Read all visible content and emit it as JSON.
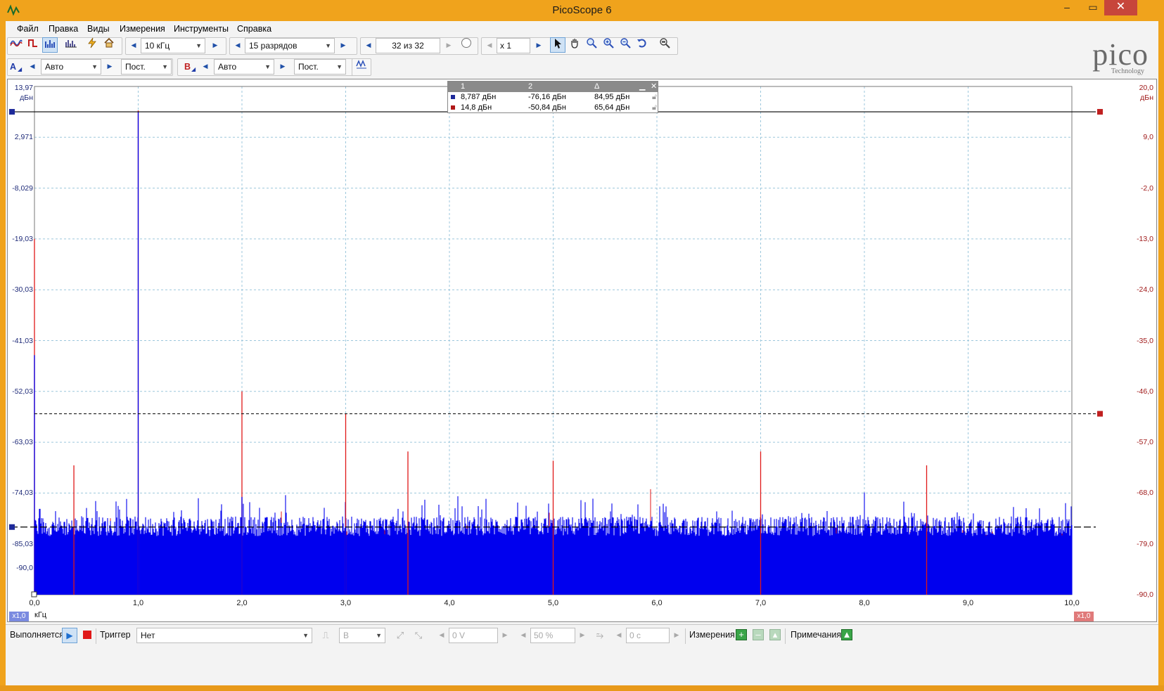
{
  "window": {
    "title": "PicoScope 6",
    "minimize": "–",
    "maximize": "▭",
    "close": "✕"
  },
  "menu": [
    "Файл",
    "Правка",
    "Виды",
    "Измерения",
    "Инструменты",
    "Справка"
  ],
  "toolbar1": {
    "freq_range": "10 кГц",
    "resolution": "15 разрядов",
    "buffer": "32 из 32",
    "zoom": "x 1"
  },
  "toolbar2": {
    "channel_a_label": "A",
    "channel_a_range": "Авто",
    "channel_a_coupling": "Пост.",
    "channel_b_label": "B",
    "channel_b_range": "Авто",
    "channel_b_coupling": "Пост."
  },
  "logo": {
    "text": "pico",
    "sub": "Technology"
  },
  "chart_data": {
    "type": "line",
    "xlabel": "кГц",
    "x_ticks": [
      "0,0",
      "1,0",
      "2,0",
      "3,0",
      "4,0",
      "5,0",
      "6,0",
      "7,0",
      "8,0",
      "9,0",
      "10,0"
    ],
    "xlim": [
      0,
      10
    ],
    "left_axis": {
      "unit": "дБн",
      "ticks": [
        "13,97",
        "2,971",
        "-8,029",
        "-19,03",
        "-30,03",
        "-41,03",
        "-52,03",
        "-63,03",
        "-74,03",
        "-85,03",
        "-90,0"
      ],
      "ylim": [
        -90,
        13.97
      ],
      "color": "#1e2a78"
    },
    "right_axis": {
      "unit": "дБн",
      "ticks": [
        "20,0",
        "9,0",
        "-2,0",
        "-13,0",
        "-24,0",
        "-35,0",
        "-46,0",
        "-57,0",
        "-68,0",
        "-79,0",
        "-90,0"
      ],
      "ylim": [
        -90,
        20
      ],
      "color": "#a01a1a"
    },
    "series": [
      {
        "color": "#0000ee",
        "noise_floor_db": -78,
        "peaks": [
          {
            "x": 0.0,
            "y": -41
          },
          {
            "x": 1.0,
            "y": 8.79
          },
          {
            "x": 2.0,
            "y": -70
          },
          {
            "x": 3.0,
            "y": -76.16
          }
        ]
      },
      {
        "color": "#e01818",
        "noise_floor_db": -80,
        "peaks": [
          {
            "x": 0.0,
            "y": -13
          },
          {
            "x": 0.38,
            "y": -62
          },
          {
            "x": 1.0,
            "y": 14.8
          },
          {
            "x": 2.0,
            "y": -46
          },
          {
            "x": 3.0,
            "y": -50.84
          },
          {
            "x": 3.6,
            "y": -59
          },
          {
            "x": 5.0,
            "y": -61
          },
          {
            "x": 7.0,
            "y": -59
          },
          {
            "x": 8.6,
            "y": -62
          }
        ]
      }
    ],
    "rulers": [
      {
        "label": "1",
        "y_left_db": 8.787
      },
      {
        "label": "2",
        "y_left_db": -76.16
      }
    ],
    "scale_tag_left": "x1,0",
    "scale_tag_right": "x1,0"
  },
  "measure_table": {
    "headers": [
      "1",
      "2",
      "Δ"
    ],
    "rows": [
      {
        "v1": "8,787 дБн",
        "v2": "-76,16 дБн",
        "d": "84,95 дБн",
        "color": "#1e2a9a"
      },
      {
        "v1": "14,8 дБн",
        "v2": "-50,84 дБн",
        "d": "65,64 дБн",
        "color": "#b01818"
      }
    ]
  },
  "status": {
    "run_label": "Выполняется",
    "trigger_label": "Триггер",
    "trigger_mode": "Нет",
    "source": "B",
    "level": "0 V",
    "pretrigger": "50 %",
    "delay": "0 с",
    "measurements_label": "Измерения",
    "notes_label": "Примечания"
  }
}
